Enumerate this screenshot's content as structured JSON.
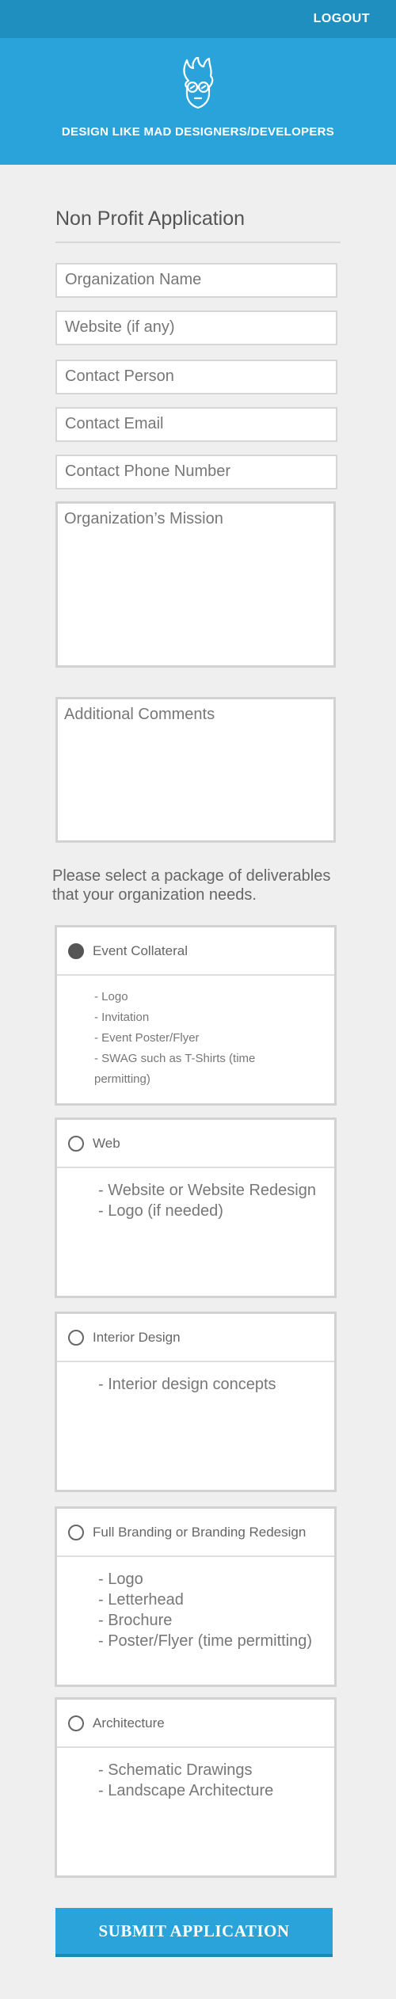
{
  "header": {
    "logout_label": "LOGOUT",
    "logo_icon": "flame-mascot-icon",
    "tagline": "DESIGN LIKE MAD DESIGNERS/DEVELOPERS",
    "colors": {
      "topbar": "#1f8fc0",
      "hero": "#2aa3db"
    }
  },
  "form": {
    "title": "Non Profit Application",
    "fields": {
      "org_name": {
        "placeholder": "Organization Name",
        "value": ""
      },
      "website": {
        "placeholder": "Website (if any)",
        "value": ""
      },
      "contact_person": {
        "placeholder": "Contact Person",
        "value": ""
      },
      "contact_email": {
        "placeholder": "Contact Email",
        "value": ""
      },
      "contact_phone": {
        "placeholder": "Contact Phone Number",
        "value": ""
      },
      "mission": {
        "placeholder": "Organization’s Mission",
        "value": ""
      },
      "comments": {
        "placeholder": "Additional Comments",
        "value": ""
      }
    },
    "package_prompt": "Please select a package of deliverables that your organization needs.",
    "packages": [
      {
        "name": "Event Collateral",
        "selected": true,
        "items": [
          "- Logo",
          "- Invitation",
          "- Event Poster/Flyer",
          "- SWAG such as T-Shirts (time",
          "permitting)"
        ]
      },
      {
        "name": "Web",
        "selected": false,
        "items": [
          "- Website or Website Redesign",
          "- Logo (if needed)"
        ]
      },
      {
        "name": "Interior Design",
        "selected": false,
        "items": [
          "- Interior design concepts"
        ]
      },
      {
        "name": "Full Branding or Branding Redesign",
        "selected": false,
        "items": [
          "- Logo",
          "- Letterhead",
          "- Brochure",
          "- Poster/Flyer (time permitting)"
        ]
      },
      {
        "name": "Architecture",
        "selected": false,
        "items": [
          "- Schematic Drawings",
          "- Landscape Architecture"
        ]
      }
    ],
    "submit_label": "SUBMIT APPLICATION"
  }
}
